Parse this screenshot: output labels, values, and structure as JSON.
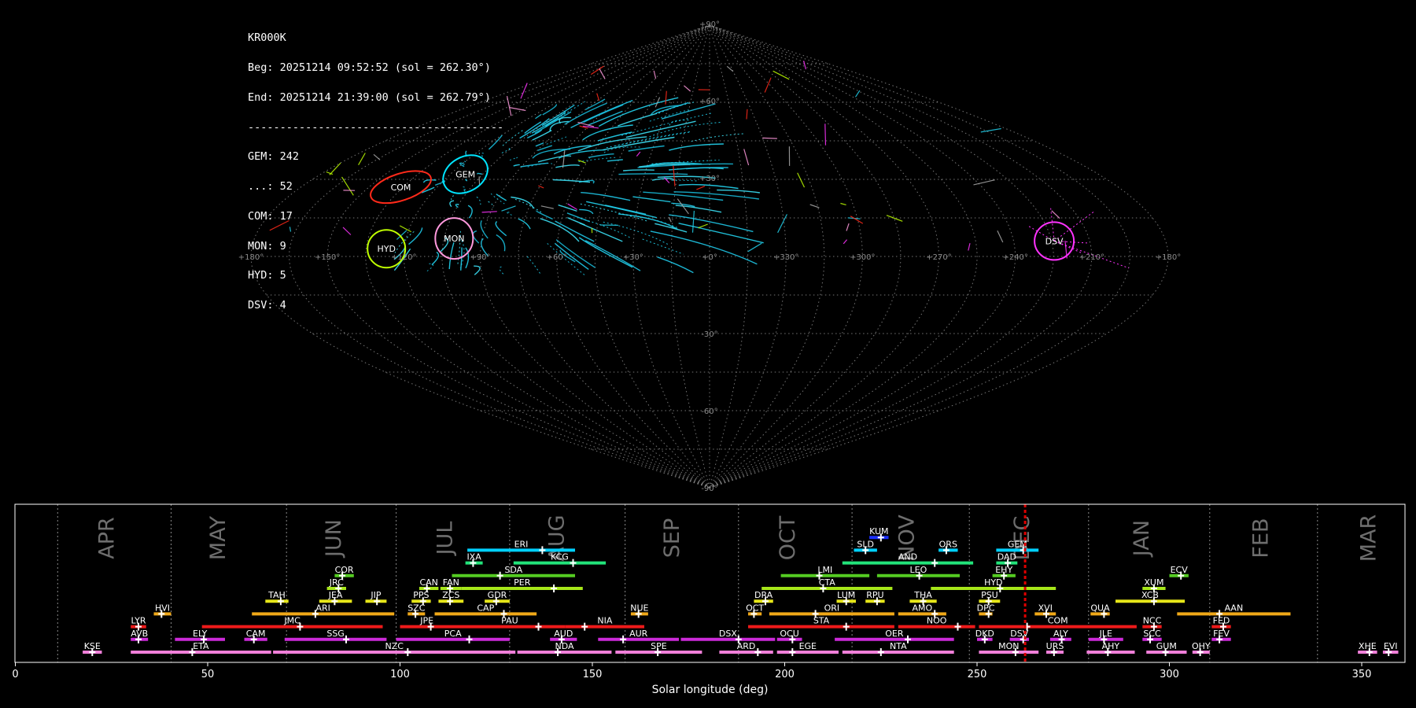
{
  "header": {
    "station": "KR000K",
    "beg": "Beg: 20251214 09:52:52 (sol = 262.30°)",
    "end": "End: 20251214 21:39:00 (sol = 262.79°)",
    "separator": "----------------------------------------",
    "counts": [
      "GEM: 242",
      "...: 52",
      "COM: 17",
      "MON: 9",
      "HYD: 5",
      "DSV: 4"
    ]
  },
  "skymap": {
    "lon_tick_labels": [
      "+180°",
      "+150°",
      "+120°",
      "+90°",
      "+60°",
      "+30°",
      "+0°",
      "+330°",
      "+300°",
      "+270°",
      "+240°",
      "+210°",
      "+180°"
    ],
    "lat_tick_labels": [
      "+90°",
      "+60°",
      "+30°",
      "-30°",
      "-60°",
      "-90°"
    ],
    "radiants": [
      {
        "code": "COM",
        "lon": 136,
        "lat": 27,
        "color": "#ff2a1a"
      },
      {
        "code": "GEM",
        "lon": 113,
        "lat": 32,
        "color": "#00e5ff"
      },
      {
        "code": "MON",
        "lon": 101,
        "lat": 7,
        "color": "#ff99dd"
      },
      {
        "code": "HYD",
        "lon": 127,
        "lat": 3,
        "color": "#bfff00"
      },
      {
        "code": "DSV",
        "lon": 224,
        "lat": 6,
        "color": "#ff33ff"
      }
    ],
    "colors": {
      "grid": "#8a8a8a",
      "primary": "#22d3ee",
      "sporadic": "#ff33ff"
    }
  },
  "chart_data": {
    "type": "timeline",
    "xlabel": "Solar longitude (deg)",
    "xlim": [
      0,
      362
    ],
    "x_ticks": [
      0,
      50,
      100,
      150,
      200,
      250,
      300,
      350
    ],
    "current_sol": 262.5,
    "months": [
      {
        "name": "APR",
        "label_x": 24
      },
      {
        "name": "MAY",
        "label_x": 53
      },
      {
        "name": "JUN",
        "label_x": 83
      },
      {
        "name": "JUL",
        "label_x": 112
      },
      {
        "name": "AUG",
        "label_x": 141
      },
      {
        "name": "SEP",
        "label_x": 171
      },
      {
        "name": "OCT",
        "label_x": 201
      },
      {
        "name": "NOV",
        "label_x": 232
      },
      {
        "name": "DEC",
        "label_x": 262
      },
      {
        "name": "JAN",
        "label_x": 293
      },
      {
        "name": "FEB",
        "label_x": 324
      },
      {
        "name": "MAR",
        "label_x": 352
      }
    ],
    "month_dividers": [
      11,
      40.5,
      70.5,
      99,
      128.5,
      158.5,
      188,
      217.5,
      248,
      279,
      310.5,
      338.5
    ],
    "showers": [
      {
        "code": "KUM",
        "start": 222,
        "end": 227,
        "peak": 225,
        "row": 10,
        "color": "#1a2fff"
      },
      {
        "code": "ERI",
        "start": 117.5,
        "end": 145.5,
        "peak": 137,
        "row": 9,
        "color": "#00d0ff"
      },
      {
        "code": "SLD",
        "start": 218,
        "end": 224,
        "peak": 221,
        "row": 9,
        "color": "#00d0ff"
      },
      {
        "code": "ORS",
        "start": 240,
        "end": 245,
        "peak": 242,
        "row": 9,
        "color": "#00d0ff"
      },
      {
        "code": "GEM",
        "start": 255,
        "end": 266,
        "peak": 262,
        "row": 9,
        "color": "#00d0ff"
      },
      {
        "code": "IXA",
        "start": 117,
        "end": 121.5,
        "peak": 119,
        "row": 8,
        "color": "#22e47a"
      },
      {
        "code": "KCG",
        "start": 129.5,
        "end": 153.5,
        "peak": 145,
        "row": 8,
        "color": "#22e47a"
      },
      {
        "code": "AND",
        "start": 215,
        "end": 249,
        "peak": 239,
        "row": 8,
        "color": "#22e47a"
      },
      {
        "code": "DAD",
        "start": 255,
        "end": 260.5,
        "peak": 258,
        "row": 8,
        "color": "#22e47a"
      },
      {
        "code": "COR",
        "start": 83,
        "end": 88,
        "peak": 85,
        "row": 7,
        "color": "#55cc22"
      },
      {
        "code": "SDA",
        "start": 113.5,
        "end": 145.5,
        "peak": 126,
        "row": 7,
        "color": "#55cc22"
      },
      {
        "code": "LMI",
        "start": 199,
        "end": 222,
        "peak": 209,
        "row": 7,
        "color": "#55cc22"
      },
      {
        "code": "LEO",
        "start": 224,
        "end": 245.5,
        "peak": 235,
        "row": 7,
        "color": "#55cc22"
      },
      {
        "code": "EHY",
        "start": 254,
        "end": 260,
        "peak": 257,
        "row": 7,
        "color": "#55cc22"
      },
      {
        "code": "ECV",
        "start": 300,
        "end": 305,
        "peak": 303,
        "row": 7,
        "color": "#55cc22"
      },
      {
        "code": "JRC",
        "start": 81,
        "end": 86,
        "peak": 84,
        "row": 6,
        "color": "#a6e619"
      },
      {
        "code": "CAN",
        "start": 105,
        "end": 110,
        "peak": 107,
        "row": 6,
        "color": "#a6e619"
      },
      {
        "code": "FAN",
        "start": 110.5,
        "end": 116,
        "peak": 113,
        "row": 6,
        "color": "#a6e619"
      },
      {
        "code": "PER",
        "start": 116,
        "end": 147.5,
        "peak": 140,
        "row": 6,
        "color": "#a6e619"
      },
      {
        "code": "CTA",
        "start": 194,
        "end": 228,
        "peak": 210,
        "row": 6,
        "color": "#a6e619"
      },
      {
        "code": "HYD",
        "start": 238,
        "end": 270.5,
        "peak": 256,
        "row": 6,
        "color": "#a6e619"
      },
      {
        "code": "XUM",
        "start": 293,
        "end": 299,
        "peak": 296,
        "row": 6,
        "color": "#a6e619"
      },
      {
        "code": "TAH",
        "start": 65,
        "end": 71,
        "peak": 69,
        "row": 5,
        "color": "#e6e619"
      },
      {
        "code": "JEA",
        "start": 79,
        "end": 87.5,
        "peak": 83,
        "row": 5,
        "color": "#e6e619"
      },
      {
        "code": "JIP",
        "start": 91,
        "end": 96.5,
        "peak": 94,
        "row": 5,
        "color": "#e6e619"
      },
      {
        "code": "PPS",
        "start": 103,
        "end": 108,
        "peak": 106,
        "row": 5,
        "color": "#e6e619"
      },
      {
        "code": "ZCS",
        "start": 110,
        "end": 116.5,
        "peak": 113,
        "row": 5,
        "color": "#e6e619"
      },
      {
        "code": "GDR",
        "start": 122,
        "end": 128.5,
        "peak": 125,
        "row": 5,
        "color": "#e6e619"
      },
      {
        "code": "DRA",
        "start": 192,
        "end": 197,
        "peak": 195,
        "row": 5,
        "color": "#e6e619"
      },
      {
        "code": "LUM",
        "start": 213.5,
        "end": 218.5,
        "peak": 216,
        "row": 5,
        "color": "#e6e619"
      },
      {
        "code": "RPU",
        "start": 221,
        "end": 226,
        "peak": 224,
        "row": 5,
        "color": "#e6e619"
      },
      {
        "code": "THA",
        "start": 232.5,
        "end": 239.5,
        "peak": 236,
        "row": 5,
        "color": "#e6e619"
      },
      {
        "code": "PSU",
        "start": 250.5,
        "end": 256,
        "peak": 253,
        "row": 5,
        "color": "#e6e619"
      },
      {
        "code": "XCB",
        "start": 286,
        "end": 304,
        "peak": 296,
        "row": 5,
        "color": "#e6e619"
      },
      {
        "code": "HVI",
        "start": 36,
        "end": 40.5,
        "peak": 38,
        "row": 4,
        "color": "#f0a818"
      },
      {
        "code": "ARI",
        "start": 61.5,
        "end": 98.5,
        "peak": 78,
        "row": 4,
        "color": "#f0a818"
      },
      {
        "code": "SZC",
        "start": 102,
        "end": 106.5,
        "peak": 104,
        "row": 4,
        "color": "#f0a818"
      },
      {
        "code": "CAP",
        "start": 109,
        "end": 135.5,
        "peak": 127,
        "row": 4,
        "color": "#f0a818"
      },
      {
        "code": "NUE",
        "start": 160,
        "end": 164.5,
        "peak": 162,
        "row": 4,
        "color": "#f0a818"
      },
      {
        "code": "OCT",
        "start": 190.5,
        "end": 194,
        "peak": 192,
        "row": 4,
        "color": "#f0a818"
      },
      {
        "code": "ORI",
        "start": 196,
        "end": 228.5,
        "peak": 208,
        "row": 4,
        "color": "#f0a818"
      },
      {
        "code": "AMO",
        "start": 229.5,
        "end": 242,
        "peak": 239,
        "row": 4,
        "color": "#f0a818"
      },
      {
        "code": "DPC",
        "start": 250.5,
        "end": 254,
        "peak": 253,
        "row": 4,
        "color": "#f0a818"
      },
      {
        "code": "XVI",
        "start": 265,
        "end": 270.5,
        "peak": 268,
        "row": 4,
        "color": "#f0a818"
      },
      {
        "code": "QUA",
        "start": 279.5,
        "end": 284.5,
        "peak": 283,
        "row": 4,
        "color": "#f0a818"
      },
      {
        "code": "AAN",
        "start": 302,
        "end": 331.5,
        "peak": 313,
        "row": 4,
        "color": "#f0a818"
      },
      {
        "code": "LYR",
        "start": 30,
        "end": 34,
        "peak": 32,
        "row": 3,
        "color": "#ee1a1a"
      },
      {
        "code": "JMC",
        "start": 48.5,
        "end": 95.5,
        "peak": 74,
        "row": 3,
        "color": "#ee1a1a"
      },
      {
        "code": "JPE",
        "start": 100,
        "end": 114,
        "peak": 108,
        "row": 3,
        "color": "#ee1a1a"
      },
      {
        "code": "PAU",
        "start": 114,
        "end": 143,
        "peak": 136,
        "row": 3,
        "color": "#ee1a1a"
      },
      {
        "code": "NIA",
        "start": 143,
        "end": 163.5,
        "peak": 148,
        "row": 3,
        "color": "#ee1a1a"
      },
      {
        "code": "STA",
        "start": 190.5,
        "end": 228.5,
        "peak": 216,
        "row": 3,
        "color": "#ee1a1a"
      },
      {
        "code": "NOO",
        "start": 229.5,
        "end": 249.5,
        "peak": 245,
        "row": 3,
        "color": "#ee1a1a"
      },
      {
        "code": "COM",
        "start": 250.5,
        "end": 291.5,
        "peak": 263,
        "row": 3,
        "color": "#ee1a1a"
      },
      {
        "code": "NCC",
        "start": 293,
        "end": 298,
        "peak": 296,
        "row": 3,
        "color": "#ee1a1a"
      },
      {
        "code": "FED",
        "start": 311,
        "end": 316,
        "peak": 314,
        "row": 3,
        "color": "#ee1a1a"
      },
      {
        "code": "AVB",
        "start": 30,
        "end": 34.5,
        "peak": 32,
        "row": 2,
        "color": "#cc2ad9"
      },
      {
        "code": "ELY",
        "start": 41.5,
        "end": 54.5,
        "peak": 49,
        "row": 2,
        "color": "#cc2ad9"
      },
      {
        "code": "CAM",
        "start": 59.5,
        "end": 65.5,
        "peak": 62,
        "row": 2,
        "color": "#cc2ad9"
      },
      {
        "code": "SSG",
        "start": 70,
        "end": 96.5,
        "peak": 86,
        "row": 2,
        "color": "#cc2ad9"
      },
      {
        "code": "PCA",
        "start": 99,
        "end": 128.5,
        "peak": 118,
        "row": 2,
        "color": "#cc2ad9"
      },
      {
        "code": "AUD",
        "start": 139,
        "end": 146,
        "peak": 142,
        "row": 2,
        "color": "#cc2ad9"
      },
      {
        "code": "AUR",
        "start": 151.5,
        "end": 172.5,
        "peak": 158,
        "row": 2,
        "color": "#cc2ad9"
      },
      {
        "code": "DSX",
        "start": 173,
        "end": 197.5,
        "peak": 188,
        "row": 2,
        "color": "#cc2ad9"
      },
      {
        "code": "OCU",
        "start": 198,
        "end": 204.5,
        "peak": 202,
        "row": 2,
        "color": "#cc2ad9"
      },
      {
        "code": "OER",
        "start": 213,
        "end": 244,
        "peak": 232,
        "row": 2,
        "color": "#cc2ad9"
      },
      {
        "code": "DKD",
        "start": 250,
        "end": 254,
        "peak": 252,
        "row": 2,
        "color": "#cc2ad9"
      },
      {
        "code": "DSV",
        "start": 258.5,
        "end": 263.5,
        "peak": 262,
        "row": 2,
        "color": "#cc2ad9"
      },
      {
        "code": "ALY",
        "start": 269,
        "end": 274.5,
        "peak": 272,
        "row": 2,
        "color": "#cc2ad9"
      },
      {
        "code": "JLE",
        "start": 279,
        "end": 288,
        "peak": 283,
        "row": 2,
        "color": "#cc2ad9"
      },
      {
        "code": "SCC",
        "start": 293,
        "end": 298,
        "peak": 295,
        "row": 2,
        "color": "#cc2ad9"
      },
      {
        "code": "FEV",
        "start": 311,
        "end": 316,
        "peak": 313,
        "row": 2,
        "color": "#cc2ad9"
      },
      {
        "code": "KSE",
        "start": 17.5,
        "end": 22.5,
        "peak": 20,
        "row": 1,
        "color": "#f07fd9"
      },
      {
        "code": "ETA",
        "start": 30,
        "end": 66.5,
        "peak": 46,
        "row": 1,
        "color": "#f07fd9"
      },
      {
        "code": "NZC",
        "start": 67,
        "end": 130,
        "peak": 102,
        "row": 1,
        "color": "#f07fd9"
      },
      {
        "code": "NDA",
        "start": 130.5,
        "end": 155,
        "peak": 141,
        "row": 1,
        "color": "#f07fd9"
      },
      {
        "code": "SPE",
        "start": 156,
        "end": 178.5,
        "peak": 167,
        "row": 1,
        "color": "#f07fd9"
      },
      {
        "code": "ARD",
        "start": 183,
        "end": 197,
        "peak": 193,
        "row": 1,
        "color": "#f07fd9"
      },
      {
        "code": "EGE",
        "start": 198,
        "end": 214,
        "peak": 202,
        "row": 1,
        "color": "#f07fd9"
      },
      {
        "code": "NTA",
        "start": 215,
        "end": 244,
        "peak": 225,
        "row": 1,
        "color": "#f07fd9"
      },
      {
        "code": "MON",
        "start": 250.5,
        "end": 266,
        "peak": 260,
        "row": 1,
        "color": "#f07fd9"
      },
      {
        "code": "URS",
        "start": 268,
        "end": 272.5,
        "peak": 270,
        "row": 1,
        "color": "#f07fd9"
      },
      {
        "code": "AHY",
        "start": 278.5,
        "end": 291,
        "peak": 284,
        "row": 1,
        "color": "#f07fd9"
      },
      {
        "code": "GUM",
        "start": 294,
        "end": 304.5,
        "peak": 299,
        "row": 1,
        "color": "#f07fd9"
      },
      {
        "code": "OHY",
        "start": 306,
        "end": 310.5,
        "peak": 308,
        "row": 1,
        "color": "#f07fd9"
      },
      {
        "code": "XHE",
        "start": 349,
        "end": 354,
        "peak": 352,
        "row": 1,
        "color": "#f07fd9"
      },
      {
        "code": "EVI",
        "start": 355.5,
        "end": 359.5,
        "peak": 357,
        "row": 1,
        "color": "#f07fd9"
      }
    ]
  }
}
